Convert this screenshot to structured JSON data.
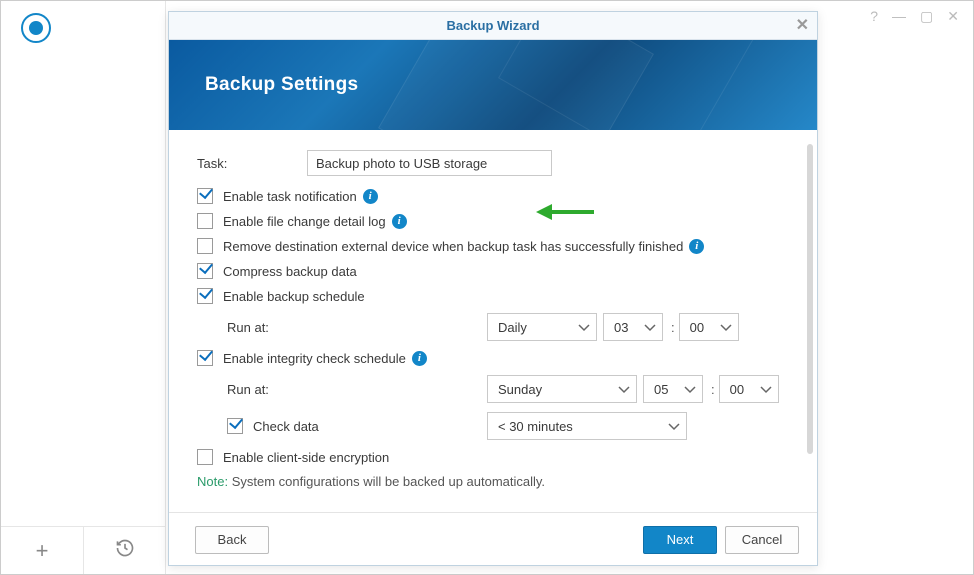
{
  "outer": {
    "help": "?",
    "min": "—",
    "max": "▢",
    "close": "✕"
  },
  "sidebar": {
    "add": "+"
  },
  "modal": {
    "title": "Backup Wizard",
    "close": "✕",
    "banner_title": "Backup Settings"
  },
  "form": {
    "task_label": "Task:",
    "task_value": "Backup photo to USB storage",
    "cb_notification": "Enable task notification",
    "cb_filelog": "Enable file change detail log",
    "cb_remove_device": "Remove destination external device when backup task has successfully finished",
    "cb_compress": "Compress backup data",
    "cb_schedule": "Enable backup schedule",
    "run_at": "Run at:",
    "sched_freq": "Daily",
    "sched_hour": "03",
    "sched_min": "00",
    "cb_integrity": "Enable integrity check schedule",
    "int_freq": "Sunday",
    "int_hour": "05",
    "int_min": "00",
    "cb_checkdata": "Check data",
    "check_duration": "< 30 minutes",
    "cb_encryption": "Enable client-side encryption",
    "note_label": "Note:",
    "note_text": " System configurations will be backed up automatically."
  },
  "footer": {
    "back": "Back",
    "next": "Next",
    "cancel": "Cancel"
  },
  "icons": {
    "info": "i"
  }
}
